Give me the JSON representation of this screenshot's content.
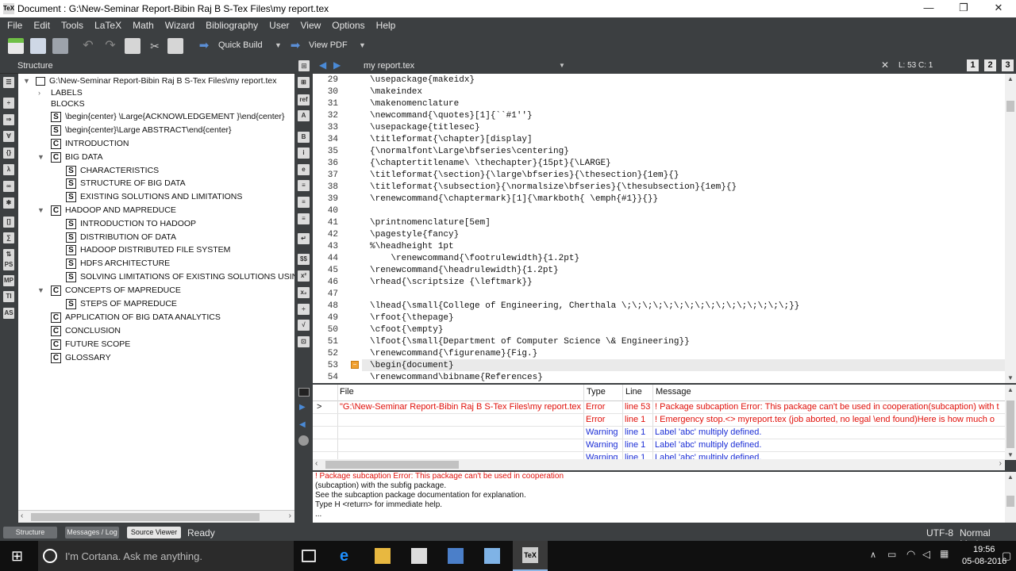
{
  "window": {
    "title": "Document : G:\\New-Seminar Report-Bibin Raj B S-Tex Files\\my report.tex",
    "app_icon": "TeX",
    "min_icon": "—",
    "max_icon": "❐",
    "close_icon": "✕"
  },
  "menu": [
    "File",
    "Edit",
    "Tools",
    "LaTeX",
    "Math",
    "Wizard",
    "Bibliography",
    "User",
    "View",
    "Options",
    "Help"
  ],
  "toolbar": {
    "quick_build": "Quick Build",
    "view_pdf": "View PDF"
  },
  "structure": {
    "title": "Structure",
    "root": "G:\\New-Seminar Report-Bibin Raj B S-Tex Files\\my report.tex",
    "items": [
      {
        "label": "LABELS",
        "type": "none"
      },
      {
        "label": "BLOCKS",
        "type": "none"
      },
      {
        "label": "\\begin{center} \\Large{ACKNOWLEDGEMENT }\\end{center}",
        "type": "S"
      },
      {
        "label": "\\begin{center}\\Large ABSTRACT\\end{center}",
        "type": "S"
      },
      {
        "label": "INTRODUCTION",
        "type": "C"
      },
      {
        "label": "BIG DATA",
        "type": "C"
      },
      {
        "label": "CHARACTERISTICS",
        "type": "S"
      },
      {
        "label": "STRUCTURE OF BIG DATA",
        "type": "S"
      },
      {
        "label": "EXISTING SOLUTIONS AND LIMITATIONS",
        "type": "S"
      },
      {
        "label": "HADOOP AND MAPREDUCE",
        "type": "C"
      },
      {
        "label": "INTRODUCTION TO HADOOP",
        "type": "S"
      },
      {
        "label": "DISTRIBUTION OF DATA",
        "type": "S"
      },
      {
        "label": "HADOOP DISTRIBUTED FILE SYSTEM",
        "type": "S"
      },
      {
        "label": "HDFS ARCHITECTURE",
        "type": "S"
      },
      {
        "label": "SOLVING LIMITATIONS OF EXISTING SOLUTIONS USING HA",
        "type": "S"
      },
      {
        "label": "CONCEPTS OF MAPREDUCE",
        "type": "C"
      },
      {
        "label": "STEPS OF MAPREDUCE",
        "type": "S"
      },
      {
        "label": "APPLICATION OF BIG DATA ANALYTICS",
        "type": "C"
      },
      {
        "label": "CONCLUSION",
        "type": "C"
      },
      {
        "label": "FUTURE SCOPE",
        "type": "C"
      },
      {
        "label": "GLOSSARY",
        "type": "C"
      }
    ]
  },
  "editor": {
    "filename": "my report.tex",
    "cursor": "L: 53 C: 1",
    "view_buttons": [
      "1",
      "2",
      "3"
    ],
    "current_line": 53,
    "lines": [
      {
        "n": "29",
        "t": "\\usepackage{makeidx}"
      },
      {
        "n": "30",
        "t": "\\makeindex"
      },
      {
        "n": "31",
        "t": "\\makenomenclature"
      },
      {
        "n": "32",
        "t": "\\newcommand{\\quotes}[1]{``#1''}"
      },
      {
        "n": "33",
        "t": "\\usepackage{titlesec}"
      },
      {
        "n": "34",
        "t": "\\titleformat{\\chapter}[display]"
      },
      {
        "n": "35",
        "t": "{\\normalfont\\Large\\bfseries\\centering}"
      },
      {
        "n": "36",
        "t": "{\\chaptertitlename\\ \\thechapter}{15pt}{\\LARGE}"
      },
      {
        "n": "37",
        "t": "\\titleformat{\\section}{\\large\\bfseries}{\\thesection}{1em}{}"
      },
      {
        "n": "38",
        "t": "\\titleformat{\\subsection}{\\normalsize\\bfseries}{\\thesubsection}{1em}{}"
      },
      {
        "n": "39",
        "t": "\\renewcommand{\\chaptermark}[1]{\\markboth{ \\emph{#1}}{}}"
      },
      {
        "n": "40",
        "t": ""
      },
      {
        "n": "41",
        "t": "\\printnomenclature[5em]"
      },
      {
        "n": "42",
        "t": "\\pagestyle{fancy}"
      },
      {
        "n": "43",
        "t": "%\\headheight 1pt"
      },
      {
        "n": "44",
        "t": "    \\renewcommand{\\footrulewidth}{1.2pt}"
      },
      {
        "n": "45",
        "t": "\\renewcommand{\\headrulewidth}{1.2pt}"
      },
      {
        "n": "46",
        "t": "\\rhead{\\scriptsize {\\leftmark}}"
      },
      {
        "n": "47",
        "t": ""
      },
      {
        "n": "48",
        "t": "\\lhead{\\small{College of Engineering, Cherthala \\;\\;\\;\\;\\;\\;\\;\\;\\;\\;\\;\\;\\;\\;\\;\\;}}"
      },
      {
        "n": "49",
        "t": "\\rfoot{\\thepage}"
      },
      {
        "n": "50",
        "t": "\\cfoot{\\empty}"
      },
      {
        "n": "51",
        "t": "\\lfoot{\\small{Department of Computer Science \\& Engineering}}"
      },
      {
        "n": "52",
        "t": "\\renewcommand{\\figurename}{Fig.}"
      },
      {
        "n": "53",
        "t": "\\begin{document}"
      },
      {
        "n": "54",
        "t": "\\renewcommand\\bibname{References}"
      }
    ]
  },
  "messages": {
    "headers": {
      "file": "File",
      "type": "Type",
      "line": "Line",
      "message": "Message"
    },
    "rows": [
      {
        "marker": ">",
        "file": "\"G:\\New-Seminar Report-Bibin Raj B S-Tex Files\\my report.tex",
        "type": "Error",
        "line": "line 53",
        "message": "! Package subcaption Error: This package can't be used in cooperation(subcaption) with t",
        "level": "error"
      },
      {
        "marker": "",
        "file": "",
        "type": "Error",
        "line": "line 1",
        "message": "! Emergency stop.<> myreport.tex (job aborted, no legal \\end found)Here is how much o",
        "level": "error"
      },
      {
        "marker": "",
        "file": "",
        "type": "Warning",
        "line": "line 1",
        "message": "Label 'abc' multiply defined.",
        "level": "warning"
      },
      {
        "marker": "",
        "file": "",
        "type": "Warning",
        "line": "line 1",
        "message": "Label 'abc' multiply defined.",
        "level": "warning"
      },
      {
        "marker": "",
        "file": "",
        "type": "Warning",
        "line": "line 1",
        "message": "Label 'abc' multiply defined.",
        "level": "warning"
      }
    ]
  },
  "log": {
    "lines": [
      "! Package subcaption Error: This package can't be used in cooperation",
      "(subcaption) with the subfig package.",
      "See the subcaption package documentation for explanation.",
      "Type H <return> for immediate help.",
      "..."
    ]
  },
  "status": {
    "tabs": [
      "Structure",
      "Messages / Log",
      "Source Viewer"
    ],
    "ready": "Ready",
    "encoding": "UTF-8",
    "mode": "Normal Mode"
  },
  "taskbar": {
    "search_placeholder": "I'm Cortana. Ask me anything.",
    "time": "19:56",
    "date": "05-08-2016"
  },
  "colors": {
    "error": "#e0100a",
    "warning": "#1c2fd6",
    "panel": "#3c3f41"
  }
}
